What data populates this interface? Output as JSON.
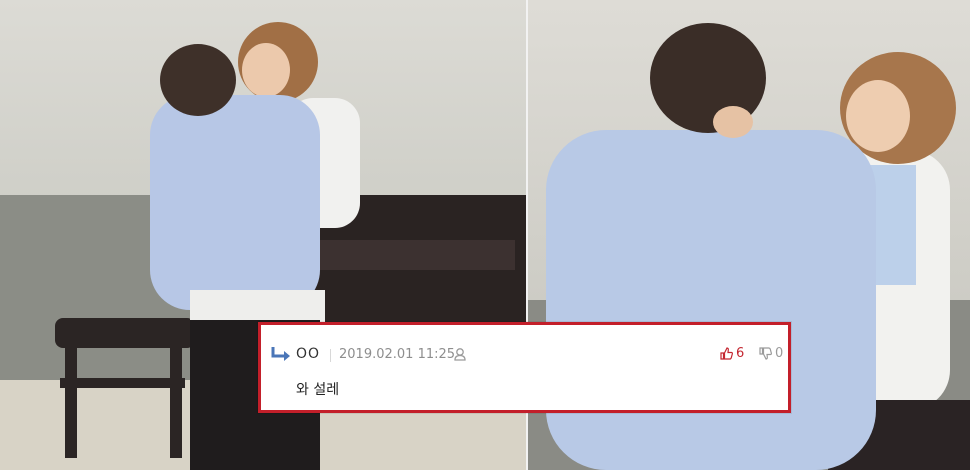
{
  "comment": {
    "user": "OO",
    "datetime": "2019.02.01 11:25",
    "likes": "6",
    "dislikes": "0",
    "text": "와 설레"
  },
  "colors": {
    "highlight_border": "#c31f2a",
    "like": "#c42630",
    "dislike": "#9a9a9a"
  },
  "icons": [
    "reply-arrow-icon",
    "user-icon",
    "thumbs-up-icon",
    "thumbs-down-icon"
  ]
}
